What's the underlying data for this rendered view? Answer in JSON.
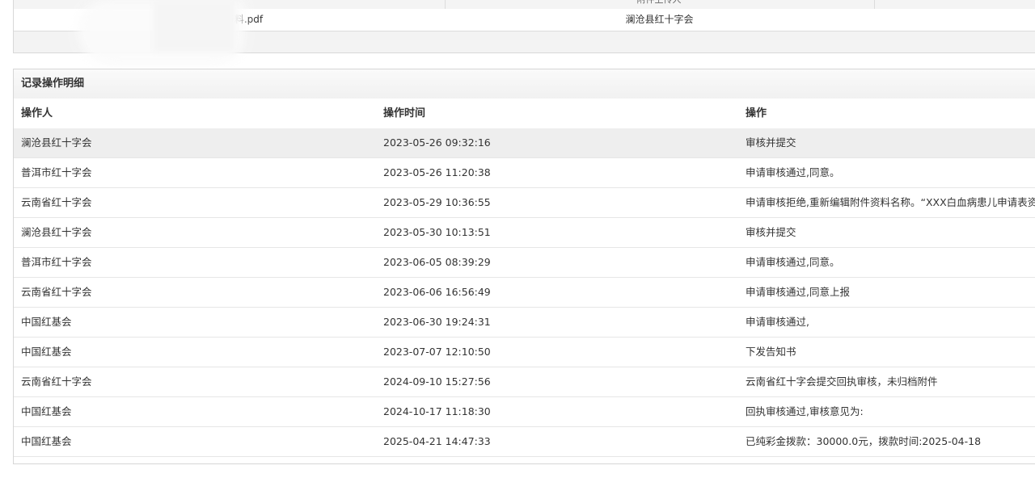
{
  "attachments": {
    "header": {
      "uploader_col": "附件上传人"
    },
    "rows": [
      {
        "filename": "申请表资料.pdf",
        "uploader": "澜沧县红十字会"
      }
    ]
  },
  "log": {
    "title": "记录操作明细",
    "columns": {
      "operator": "操作人",
      "time": "操作时间",
      "action": "操作"
    },
    "rows": [
      {
        "operator": "澜沧县红十字会",
        "time": "2023-05-26 09:32:16",
        "action": "审核并提交"
      },
      {
        "operator": "普洱市红十字会",
        "time": "2023-05-26 11:20:38",
        "action": "申请审核通过,同意。"
      },
      {
        "operator": "云南省红十字会",
        "time": "2023-05-29 10:36:55",
        "action": "申请审核拒绝,重新编辑附件资料名称。“XXX白血病患儿申请表资料”"
      },
      {
        "operator": "澜沧县红十字会",
        "time": "2023-05-30 10:13:51",
        "action": "审核并提交"
      },
      {
        "operator": "普洱市红十字会",
        "time": "2023-06-05 08:39:29",
        "action": "申请审核通过,同意。"
      },
      {
        "operator": "云南省红十字会",
        "time": "2023-06-06 16:56:49",
        "action": "申请审核通过,同意上报"
      },
      {
        "operator": "中国红基会",
        "time": "2023-06-30 19:24:31",
        "action": "申请审核通过,"
      },
      {
        "operator": "中国红基会",
        "time": "2023-07-07 12:10:50",
        "action": "下发告知书"
      },
      {
        "operator": "云南省红十字会",
        "time": "2024-09-10 15:27:56",
        "action": "云南省红十字会提交回执审核，未归档附件"
      },
      {
        "operator": "中国红基会",
        "time": "2024-10-17 11:18:30",
        "action": "回执审核通过,审核意见为:"
      },
      {
        "operator": "中国红基会",
        "time": "2025-04-21 14:47:33",
        "action": "已纯彩金拨款：30000.0元，拨款时间:2025-04-18"
      }
    ]
  }
}
